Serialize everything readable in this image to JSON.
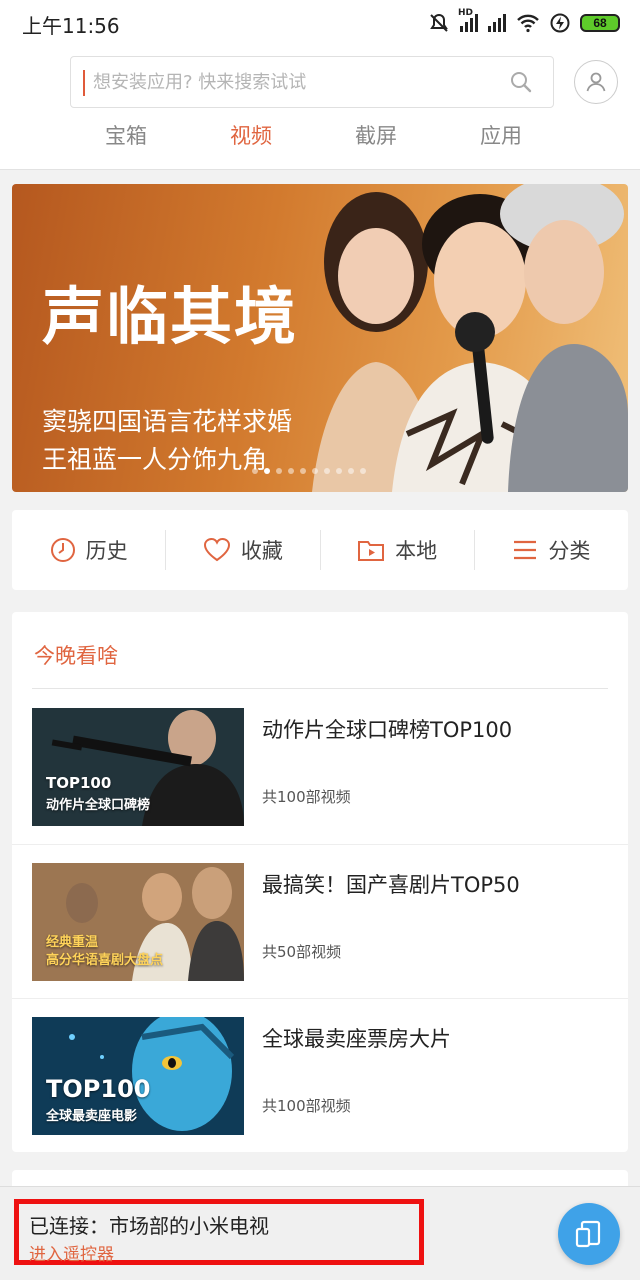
{
  "status_bar": {
    "time": "上午11:56",
    "network": "HD",
    "battery": "68"
  },
  "search": {
    "placeholder": "想安装应用? 快来搜索试试",
    "value": ""
  },
  "tabs": [
    {
      "label": "宝箱",
      "active": false
    },
    {
      "label": "视频",
      "active": true
    },
    {
      "label": "截屏",
      "active": false
    },
    {
      "label": "应用",
      "active": false
    }
  ],
  "banner": {
    "title": "声临其境",
    "line1": "窦骁四国语言花样求婚",
    "line2": "王祖蓝一人分饰九角",
    "dot_count": 10,
    "active_dot": 1
  },
  "quick_menu": [
    {
      "label": "历史",
      "icon": "clock-icon"
    },
    {
      "label": "收藏",
      "icon": "heart-icon"
    },
    {
      "label": "本地",
      "icon": "folder-play-icon"
    },
    {
      "label": "分类",
      "icon": "list-icon"
    }
  ],
  "tonight": {
    "title": "今晚看啥",
    "items": [
      {
        "title": "动作片全球口碑榜TOP100",
        "count": "共100部视频",
        "thumb_line1": "TOP100",
        "thumb_line2": "动作片全球口碑榜"
      },
      {
        "title": "最搞笑！国产喜剧片TOP50",
        "count": "共50部视频",
        "thumb_line1": "经典重温",
        "thumb_line2": "高分华语喜剧大盘点"
      },
      {
        "title": "全球最卖座票房大片",
        "count": "共100部视频",
        "thumb_line1": "TOP100",
        "thumb_line2": "全球最卖座电影"
      }
    ]
  },
  "bottom_bar": {
    "connection_status": "已连接：市场部的小米电视",
    "remote_link": "进入遥控器"
  },
  "colors": {
    "accent": "#e06540",
    "highlight_border": "#ee1111",
    "remote_button": "#3fa2e8"
  }
}
